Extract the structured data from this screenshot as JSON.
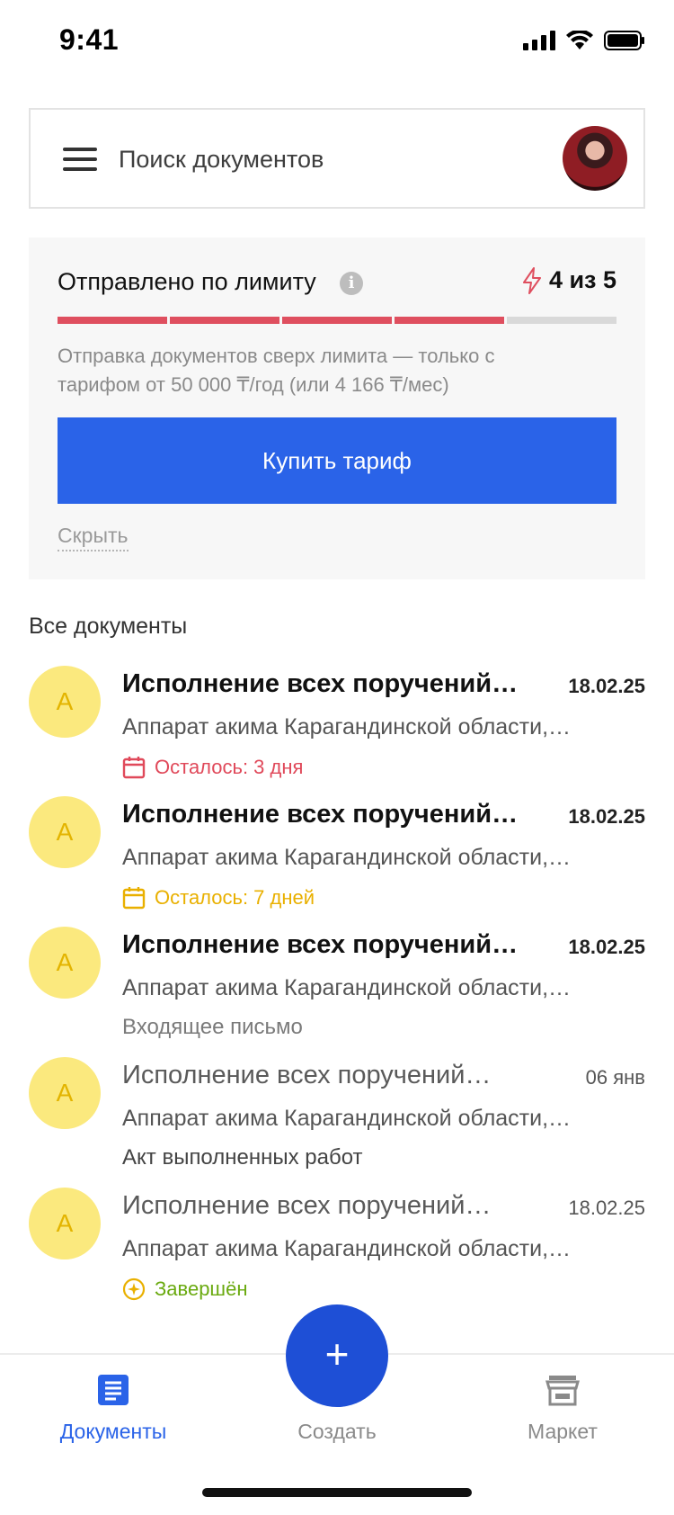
{
  "status_bar": {
    "time": "9:41"
  },
  "search": {
    "placeholder": "Поиск документов"
  },
  "limit": {
    "title": "Отправлено по лимиту",
    "count_text": "4 из 5",
    "used": 4,
    "total": 5,
    "note": "Отправка документов сверх лимита — только с тарифом от 50 000 ₸/год (или 4 166 ₸/мес)",
    "buy_label": "Купить тариф",
    "hide_label": "Скрыть"
  },
  "section_title": "Все документы",
  "documents": [
    {
      "avatar": "А",
      "title": "Исполнение всех поручений…",
      "date": "18.02.25",
      "org": "Аппарат акима Карагандинской области,…",
      "status": "Осталось: 3 дня"
    },
    {
      "avatar": "А",
      "title": "Исполнение всех поручений…",
      "date": "18.02.25",
      "org": "Аппарат акима Карагандинской области,…",
      "status": "Осталось: 7 дней"
    },
    {
      "avatar": "А",
      "title": "Исполнение всех поручений…",
      "date": "18.02.25",
      "org": "Аппарат акима Карагандинской области,…",
      "type": "Входящее письмо"
    },
    {
      "avatar": "А",
      "title": "Исполнение всех поручений…",
      "date": "06 янв",
      "org": "Аппарат акима Карагандинской области,…",
      "type": "Акт выполненных работ"
    },
    {
      "avatar": "А",
      "title": "Исполнение всех поручений…",
      "date": "18.02.25",
      "org": "Аппарат акима Карагандинской области,…",
      "status": "Завершён"
    }
  ],
  "nav": {
    "documents": "Документы",
    "create": "Создать",
    "market": "Маркет",
    "fab_symbol": "+"
  },
  "colors": {
    "accent": "#2a63e8",
    "limit_red": "#df4f5f",
    "deadline_red": "#e0495a",
    "deadline_yellow": "#e9b000",
    "done_green": "#6aaa10",
    "avatar_bg": "#fbe97e"
  }
}
